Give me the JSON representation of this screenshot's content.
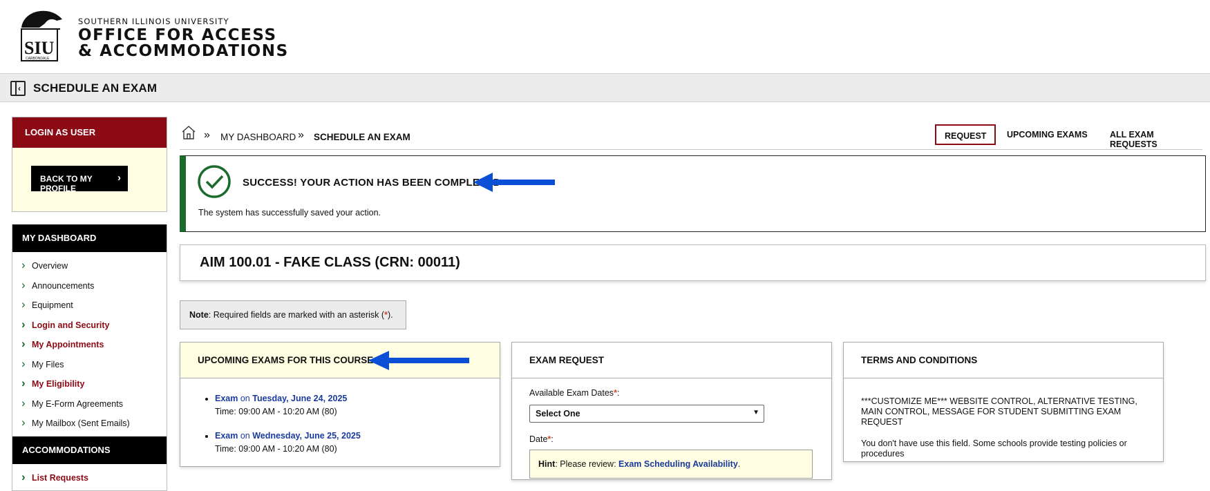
{
  "header": {
    "university": "SOUTHERN ILLINOIS UNIVERSITY",
    "office_line1": "OFFICE FOR ACCESS",
    "office_line2": "& ACCOMMODATIONS",
    "logo_text": "SIU",
    "logo_sub": "CARBONDALE"
  },
  "titlebar": {
    "title": "SCHEDULE AN EXAM",
    "icon": "collapse-sidebar-icon"
  },
  "sidebar": {
    "login_header": "LOGIN AS USER",
    "back_button": "BACK TO MY PROFILE",
    "dashboard_header": "MY DASHBOARD",
    "dashboard_items": [
      {
        "label": "Overview",
        "highlight": false
      },
      {
        "label": "Announcements",
        "highlight": false
      },
      {
        "label": "Equipment",
        "highlight": false
      },
      {
        "label": "Login and Security",
        "highlight": true
      },
      {
        "label": "My Appointments",
        "highlight": true
      },
      {
        "label": "My Files",
        "highlight": false
      },
      {
        "label": "My Eligibility",
        "highlight": true
      },
      {
        "label": "My E-Form Agreements",
        "highlight": false
      },
      {
        "label": "My Mailbox (Sent Emails)",
        "highlight": false
      }
    ],
    "accommodations_header": "ACCOMMODATIONS",
    "accommodations_items": [
      {
        "label": "List Requests"
      }
    ]
  },
  "breadcrumb": {
    "dashboard": "MY DASHBOARD",
    "current": "SCHEDULE AN EXAM"
  },
  "topnav": {
    "request": "REQUEST",
    "upcoming": "UPCOMING EXAMS",
    "all": "ALL EXAM REQUESTS"
  },
  "success": {
    "title": "SUCCESS! YOUR ACTION HAS BEEN COMPLETED",
    "message": "The system has successfully saved your action."
  },
  "course": {
    "title": "AIM 100.01 - FAKE CLASS (CRN: 00011)"
  },
  "note": {
    "label": "Note",
    "text": ": Required fields are marked with an asterisk (",
    "asterisk": "*",
    "end": ")."
  },
  "upcoming_panel": {
    "header": "UPCOMING EXAMS FOR THIS COURSE",
    "exams": [
      {
        "name": "Exam",
        "on": "on",
        "date": "Tuesday, June 24, 2025",
        "time": "Time: 09:00 AM - 10:20 AM (80)"
      },
      {
        "name": "Exam",
        "on": "on",
        "date": "Wednesday, June 25, 2025",
        "time": "Time: 09:00 AM - 10:20 AM (80)"
      }
    ]
  },
  "request_panel": {
    "header": "EXAM REQUEST",
    "dates_label": "Available Exam Dates",
    "dates_value": "Select One",
    "date_label": "Date",
    "asterisk": "*",
    "colon": ":",
    "hint_label": "Hint",
    "hint_text": ": Please review: ",
    "hint_link": "Exam Scheduling Availability",
    "hint_end": "."
  },
  "terms_panel": {
    "header": "TERMS AND CONDITIONS",
    "text1": "***CUSTOMIZE ME*** WEBSITE CONTROL, ALTERNATIVE TESTING, MAIN CONTROL, MESSAGE FOR STUDENT SUBMITTING EXAM REQUEST",
    "text2": "You don't have use this field. Some schools provide testing policies or procedures"
  },
  "colors": {
    "brand": "#8c0a14",
    "success": "#1b6b2c",
    "link": "#1a3a9c",
    "arrow": "#0a4fd6",
    "highlight_bg": "#fffee2"
  }
}
